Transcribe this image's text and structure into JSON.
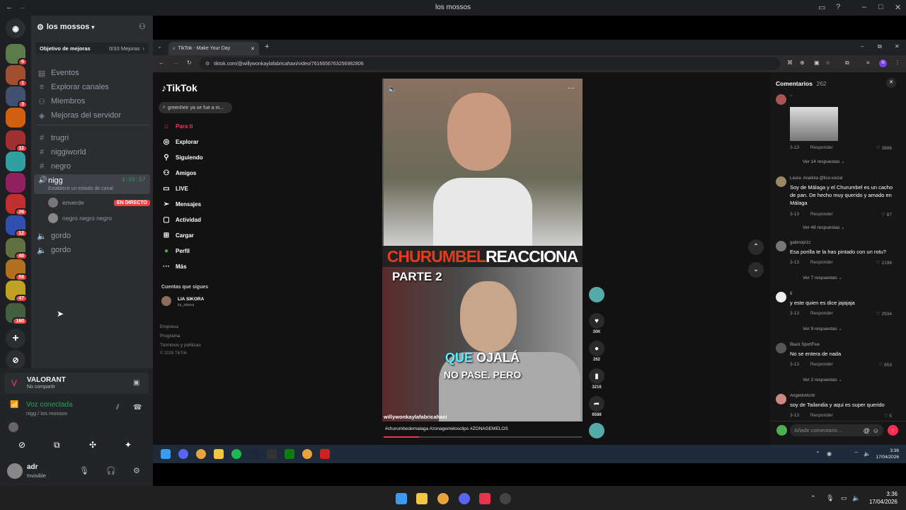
{
  "window": {
    "title": "los mossos"
  },
  "server": {
    "name": "los mossos",
    "boost_label": "Objetivo de mejoras",
    "boost_count": "0/33 Mejoras"
  },
  "rail_badges": [
    "6",
    "1",
    "3",
    "11",
    "26",
    "12",
    "40",
    "56",
    "47",
    "160"
  ],
  "nav_items": [
    {
      "label": "Eventos",
      "icon": "calendar-icon"
    },
    {
      "label": "Explorar canales",
      "icon": "list-icon"
    },
    {
      "label": "Miembros",
      "icon": "members-icon"
    },
    {
      "label": "Mejoras del servidor",
      "icon": "boost-icon"
    }
  ],
  "channels": {
    "text1": "trugri",
    "text2": "niggiworld",
    "text3": "negro",
    "voice_active": {
      "name": "nigg",
      "timer": "3:55:57",
      "status": "Establece un estado de canal"
    },
    "voice_users": [
      {
        "name": "enverde",
        "live": "EN DIRECTO"
      },
      {
        "name": "negro negro negro"
      }
    ],
    "voice2": "gordo",
    "voice3": "gordo"
  },
  "activity": {
    "game": "VALORANT",
    "sub": "No compartir"
  },
  "voice": {
    "status": "Voz conectada",
    "channel": "nigg / los mossos"
  },
  "user": {
    "name": "adr",
    "status": "Invisible"
  },
  "browser": {
    "tab_title": "TikTok - Make Your Day",
    "url": "tiktok.com/@willywonkaylafabricahaxi/video/7616656763256982806"
  },
  "tiktok": {
    "logo": "TikTok",
    "search_placeholder": "greenheir ya se fue a m...",
    "menu": [
      {
        "label": "Para ti",
        "icon": "home-icon",
        "active": true
      },
      {
        "label": "Explorar",
        "icon": "compass-icon"
      },
      {
        "label": "Siguiendo",
        "icon": "following-icon"
      },
      {
        "label": "Amigos",
        "icon": "friends-icon"
      },
      {
        "label": "LIVE",
        "icon": "live-icon"
      },
      {
        "label": "Mensajes",
        "icon": "send-icon"
      },
      {
        "label": "Actividad",
        "icon": "activity-icon"
      },
      {
        "label": "Cargar",
        "icon": "upload-icon"
      },
      {
        "label": "Perfil",
        "icon": "profile-icon"
      },
      {
        "label": "Más",
        "icon": "more-icon"
      }
    ],
    "following_header": "Cuentas que sigues",
    "following": [
      {
        "name": "LIA SIKORA",
        "handle": "lia_sikora"
      }
    ],
    "footer": [
      "Empresa",
      "Programa",
      "Términos y políticas",
      "© 2026 TikTok"
    ],
    "video": {
      "caption_top_a": "CHURUMBEL",
      "caption_top_b": "REACCIONA",
      "part": "PARTE 2",
      "sub_a": "QUE",
      "sub_b": "OJALÁ",
      "sub_c": "NO PASE. PERO",
      "author": "willywonkaylafabricahaxi",
      "hashtags": "#churumbedemalaga #zonagemelosclips #ZONAGEMELOS"
    },
    "actions": {
      "likes": "30K",
      "comments": "262",
      "saves": "3216",
      "shares": "6588"
    },
    "comments_title": "Comentarios",
    "comments_count": "262",
    "comments": [
      {
        "user": "~",
        "text": "",
        "time": "3-13",
        "reply": "Responder",
        "likes": "3886",
        "more": "Ver 14 respuestas"
      },
      {
        "user": "Laura· Analista @lico-social",
        "text": "Soy de Málaga y el Churumbel es un cacho de pan. De hecho muy querido y amado en Málaga",
        "time": "3-13",
        "reply": "Responder",
        "likes": "87",
        "more": "Ver 48 respuestas"
      },
      {
        "user": "gabinoprzz",
        "text": "Esa porilla te la has pintado con un rotu?",
        "time": "3-13",
        "reply": "Responder",
        "likes": "2196",
        "more": "Ver 7 respuestas"
      },
      {
        "user": "8",
        "text": "y este quien es dice jajajaja",
        "time": "3-13",
        "reply": "Responder",
        "likes": "2934",
        "more": "Ver 9 respuestas"
      },
      {
        "user": "Black SportFive",
        "text": "No se entera de nada",
        "time": "3-13",
        "reply": "Responder",
        "likes": "653",
        "more": "Ver 2 respuestas"
      },
      {
        "user": "Angelito9508",
        "text": "soy de Tailandia y aqui es super querido",
        "time": "3-13",
        "reply": "Responder",
        "likes": "5",
        "more": ""
      }
    ],
    "add_comment_placeholder": "Añadir comentario..."
  },
  "inner_clock": {
    "time": "3:36",
    "date": "17/04/2026"
  },
  "outer_clock": {
    "time": "3:36",
    "date": "17/04/2026"
  },
  "colors": {
    "tiktok_red": "#fe2c55",
    "discord_green": "#23a55a",
    "live_red": "#f23f43"
  }
}
